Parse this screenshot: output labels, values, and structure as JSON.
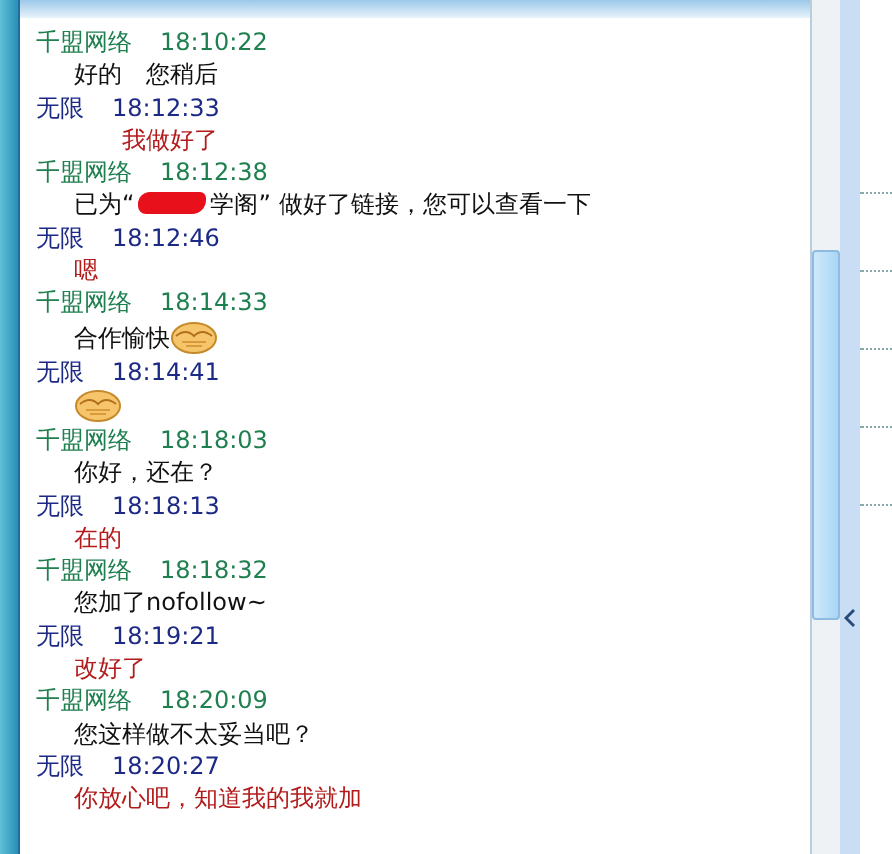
{
  "messages": [
    {
      "sender": "千盟网络",
      "kind": "peer",
      "time": "18:10:22",
      "parts": [
        {
          "kind": "text",
          "text": "好的　您稍后"
        }
      ]
    },
    {
      "sender": "无限",
      "kind": "self",
      "time": "18:12:33",
      "parts": [
        {
          "kind": "text",
          "text": "　　我做好了"
        }
      ]
    },
    {
      "sender": "千盟网络",
      "kind": "peer",
      "time": "18:12:38",
      "parts": [
        {
          "kind": "text",
          "text": "已为“"
        },
        {
          "kind": "redaction"
        },
        {
          "kind": "text",
          "text": "学阁” 做好了链接，您可以查看一下"
        }
      ]
    },
    {
      "sender": "无限",
      "kind": "self",
      "time": "18:12:46",
      "parts": [
        {
          "kind": "text",
          "text": "嗯"
        }
      ]
    },
    {
      "sender": "千盟网络",
      "kind": "peer",
      "time": "18:14:33",
      "parts": [
        {
          "kind": "text",
          "text": "合作愉快"
        },
        {
          "kind": "emoji"
        }
      ]
    },
    {
      "sender": "无限",
      "kind": "self",
      "time": "18:14:41",
      "parts": [
        {
          "kind": "emoji"
        }
      ]
    },
    {
      "sender": "千盟网络",
      "kind": "peer",
      "time": "18:18:03",
      "parts": [
        {
          "kind": "text",
          "text": "你好，还在？"
        }
      ]
    },
    {
      "sender": "无限",
      "kind": "self",
      "time": "18:18:13",
      "parts": [
        {
          "kind": "text",
          "text": "在的"
        }
      ]
    },
    {
      "sender": "千盟网络",
      "kind": "peer",
      "time": "18:18:32",
      "parts": [
        {
          "kind": "text",
          "text": "您加了nofollow~"
        }
      ]
    },
    {
      "sender": "无限",
      "kind": "self",
      "time": "18:19:21",
      "parts": [
        {
          "kind": "text",
          "text": "改好了"
        }
      ]
    },
    {
      "sender": "千盟网络",
      "kind": "peer",
      "time": "18:20:09",
      "parts": [
        {
          "kind": "text",
          "text": "您这样做不太妥当吧？"
        }
      ]
    },
    {
      "sender": "无限",
      "kind": "self",
      "time": "18:20:27",
      "parts": [
        {
          "kind": "text",
          "text": "你放心吧，知道我的我就加"
        }
      ]
    }
  ]
}
